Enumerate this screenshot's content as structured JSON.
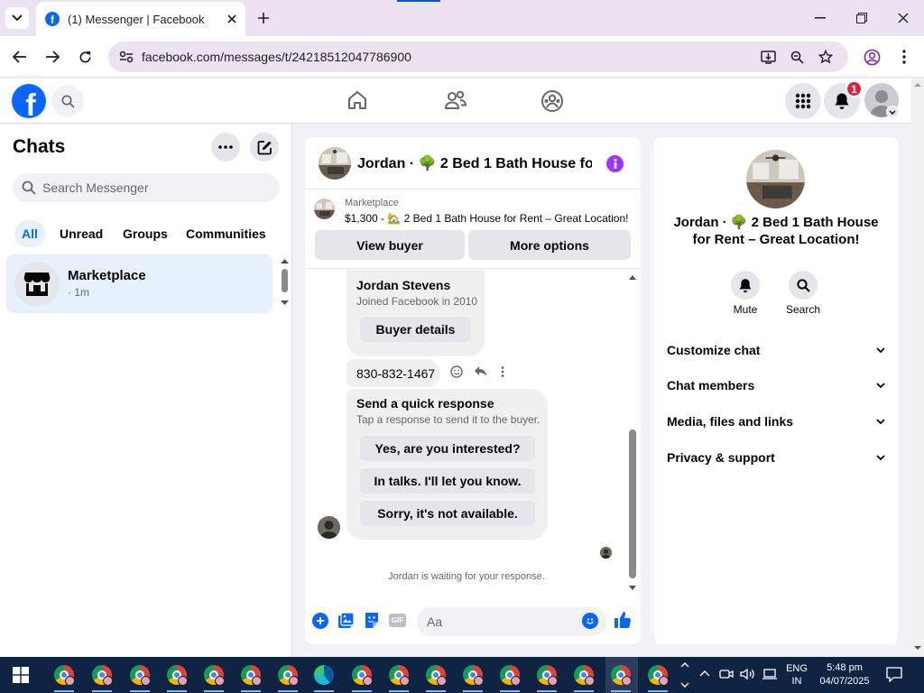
{
  "browser": {
    "tab_title": "(1) Messenger | Facebook",
    "url": "facebook.com/messages/t/24218512047786900"
  },
  "fb_header": {
    "notification_count": "1"
  },
  "chats": {
    "title": "Chats",
    "search_placeholder": "Search Messenger",
    "filters": [
      "All",
      "Unread",
      "Groups",
      "Communities"
    ],
    "items": [
      {
        "name": "Marketplace",
        "meta": "· 1m"
      }
    ]
  },
  "conversation": {
    "title": "Jordan · 🌳 2 Bed 1 Bath House for ...",
    "listing_source": "Marketplace",
    "listing_text": "$1,300 - 🏡 2 Bed 1 Bath House for Rent – Great Location!",
    "view_buyer": "View buyer",
    "more_options": "More options",
    "buyer_name": "Jordan Stevens",
    "buyer_joined": "Joined Facebook in 2010",
    "buyer_details": "Buyer details",
    "phone": "830-832-1467",
    "quick_title": "Send a quick response",
    "quick_sub": "Tap a response to send it to the buyer.",
    "quick_options": [
      "Yes, are you interested?",
      "In talks. I'll let you know.",
      "Sorry, it's not available."
    ],
    "waiting": "Jordan is waiting for your response.",
    "composer_placeholder": "Aa",
    "gif_label": "GIF"
  },
  "details": {
    "name": "Jordan · 🌳 2 Bed 1 Bath House for Rent – Great Location!",
    "mute": "Mute",
    "search": "Search",
    "sections": [
      "Customize chat",
      "Chat members",
      "Media, files and links",
      "Privacy & support"
    ]
  },
  "taskbar": {
    "lang1": "ENG",
    "lang2": "IN",
    "time": "5:48 pm",
    "date": "04/07/2025"
  },
  "colors": {
    "fb_blue": "#0866ff",
    "purple": "#a033ff",
    "taskbar": "#0f2443"
  }
}
